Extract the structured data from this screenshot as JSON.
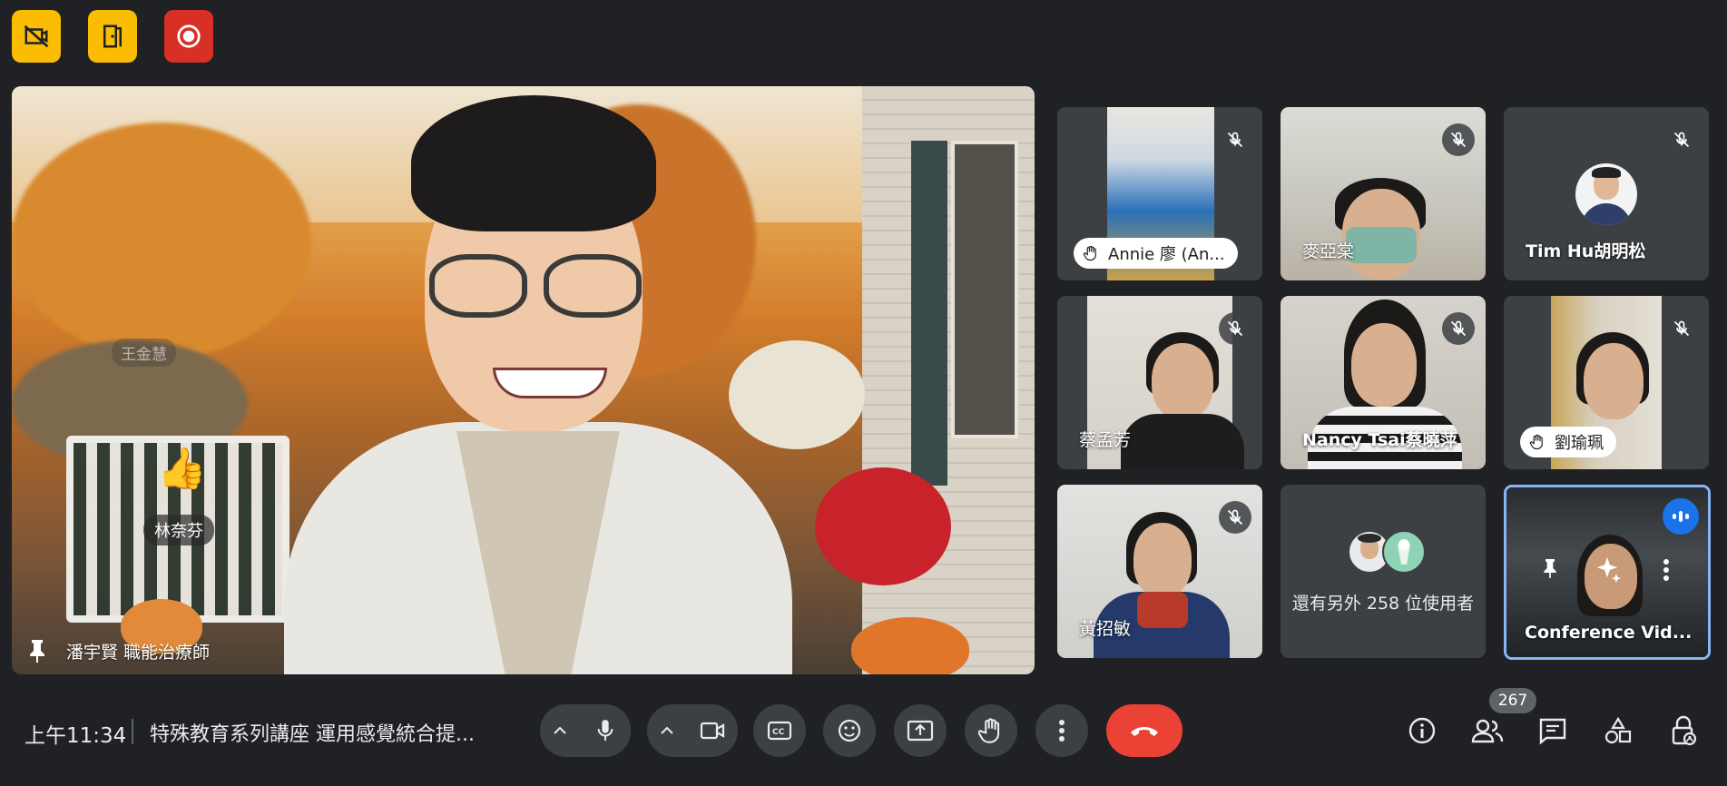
{
  "main": {
    "speaker_label": "潘宇賢 職能治療師",
    "ghost_name": "王金慧",
    "reaction_emoji": "👍",
    "reaction_name": "林奈芬"
  },
  "tiles": [
    {
      "name": "Annie 廖 (An...",
      "hand_raised": true
    },
    {
      "name": "麥亞棠",
      "hand_raised": false
    },
    {
      "name": "Tim Hu胡明松",
      "hand_raised": false
    },
    {
      "name": "蔡孟芳",
      "hand_raised": false
    },
    {
      "name": "Nancy Tsai蔡曉萍",
      "hand_raised": false
    },
    {
      "name": "劉瑜珮",
      "hand_raised": true
    },
    {
      "name": "黃招敏",
      "hand_raised": false
    },
    {
      "name": "還有另外 258 位使用者"
    },
    {
      "name": "Conference Vid..."
    }
  ],
  "bottom": {
    "time": "上午11:34",
    "meeting_title": "特殊教育系列講座 運用感覺統合提...",
    "participant_count": "267"
  },
  "colors": {
    "background": "#202124",
    "tile": "#3c4043",
    "warning_yellow": "#fbbc04",
    "record_red": "#d93025",
    "hangup_red": "#ea4335",
    "active_blue": "#8ab4f8",
    "speaking_blue": "#1a73e8"
  },
  "icons": {
    "top": [
      "no-video-recording-icon",
      "door-exit-icon",
      "record-icon"
    ],
    "controls": [
      "chevron-up-icon",
      "mic-icon",
      "camera-icon",
      "captions-icon",
      "emoji-icon",
      "present-icon",
      "raise-hand-icon",
      "more-options-icon",
      "hang-up-icon"
    ],
    "right": [
      "info-icon",
      "people-icon",
      "chat-icon",
      "activities-icon",
      "host-controls-icon"
    ]
  }
}
